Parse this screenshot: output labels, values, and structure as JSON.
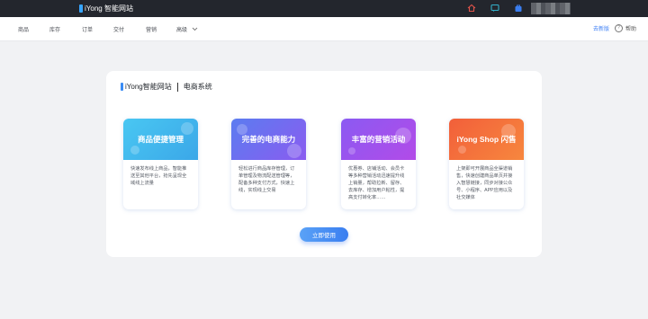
{
  "topbar": {
    "brand_name": "iYong 智能网站",
    "icons": [
      "home-icon",
      "message-icon",
      "bag-icon"
    ]
  },
  "nav": {
    "items": [
      "商品",
      "库存",
      "订单",
      "交付",
      "营销",
      "高级"
    ],
    "upgrade": "去新版",
    "help": "帮助"
  },
  "panel": {
    "brand": "iYong智能网站",
    "system": "电商系统",
    "cards": [
      {
        "title": "商品便捷管理",
        "desc": "快速发布线上商品，智能推送至其他平台，抢先呈现全域线上流量"
      },
      {
        "title": "完善的电商能力",
        "desc": "轻松进行商品库存管理，订单管理及物流配送管理等，配备多种支付方式，快速上线，实现线上交易"
      },
      {
        "title": "丰富的营销活动",
        "desc": "优惠券、店铺活动、会员卡等多种营销活动迅速提升线上销量，帮助拉新、留存、去库存、增加用户粘性，提高支付转化率……"
      },
      {
        "title": "iYong Shop 闪售",
        "desc": "上架即可开展商品全渠道销售，快速创建商品单页并接入智慧链接，同步对接公众号、小程序、APP应用以及社交媒体"
      }
    ],
    "cta": "立即使用"
  },
  "colors": {
    "topbar": "#23262d",
    "accent": "#3a7ef0",
    "card1": "#49c7f2",
    "card2": "#6f6cf0",
    "card3": "#9b52ec",
    "card4": "#f4703c"
  }
}
